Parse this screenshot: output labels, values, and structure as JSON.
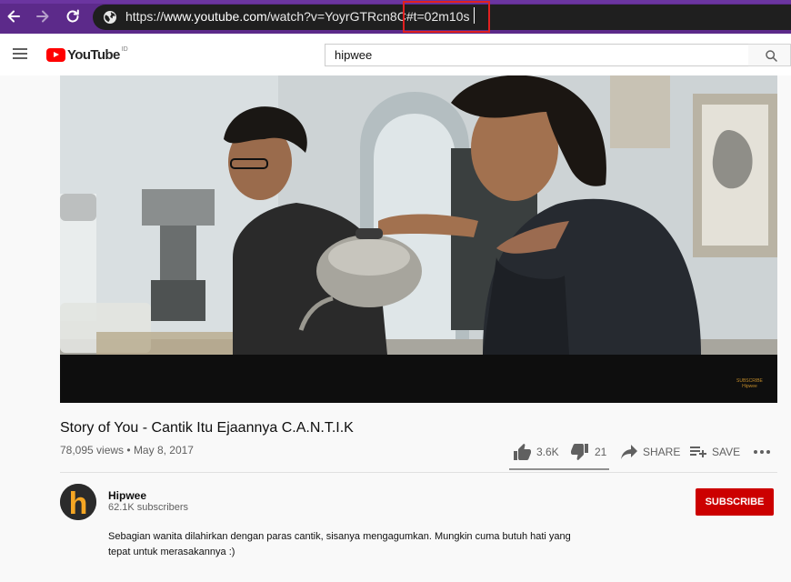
{
  "browser": {
    "url_scheme": "https://",
    "url_host": "www.youtube.com",
    "url_path": "/watch?v=YoyrGTRcn8C",
    "url_fragment": "#t=02m10s",
    "icons": [
      "back-arrow-icon",
      "forward-arrow-icon",
      "reload-icon",
      "globe-icon"
    ]
  },
  "header": {
    "logo_text": "YouTube",
    "country_code": "ID",
    "search_value": "hipwee",
    "icons": [
      "hamburger-menu-icon",
      "search-icon"
    ]
  },
  "video": {
    "watermark_line1": "SUBSCRIBE",
    "watermark_line2": "Hipwee"
  },
  "info": {
    "title": "Story of You - Cantik Itu Ejaannya C.A.N.T.I.K",
    "views": "78,095 views",
    "separator": "•",
    "date": "May 8, 2017",
    "likes": "3.6K",
    "dislikes": "21",
    "share_label": "SHARE",
    "save_label": "SAVE",
    "like_ratio": 0.994
  },
  "channel": {
    "avatar_letter": "h",
    "name": "Hipwee",
    "subscribers": "62.1K subscribers",
    "subscribe_label": "SUBSCRIBE",
    "description": "Sebagian wanita dilahirkan dengan paras cantik, sisanya mengagumkan. Mungkin cuma butuh hati yang tepat untuk merasakannya :)"
  },
  "colors": {
    "browser_bar": "#5c2a8a",
    "omnibox": "#1f1f1f",
    "highlight_box": "#e02020",
    "yt_red": "#ff0000",
    "subscribe_red": "#cc0000",
    "avatar_orange": "#f5a623"
  }
}
